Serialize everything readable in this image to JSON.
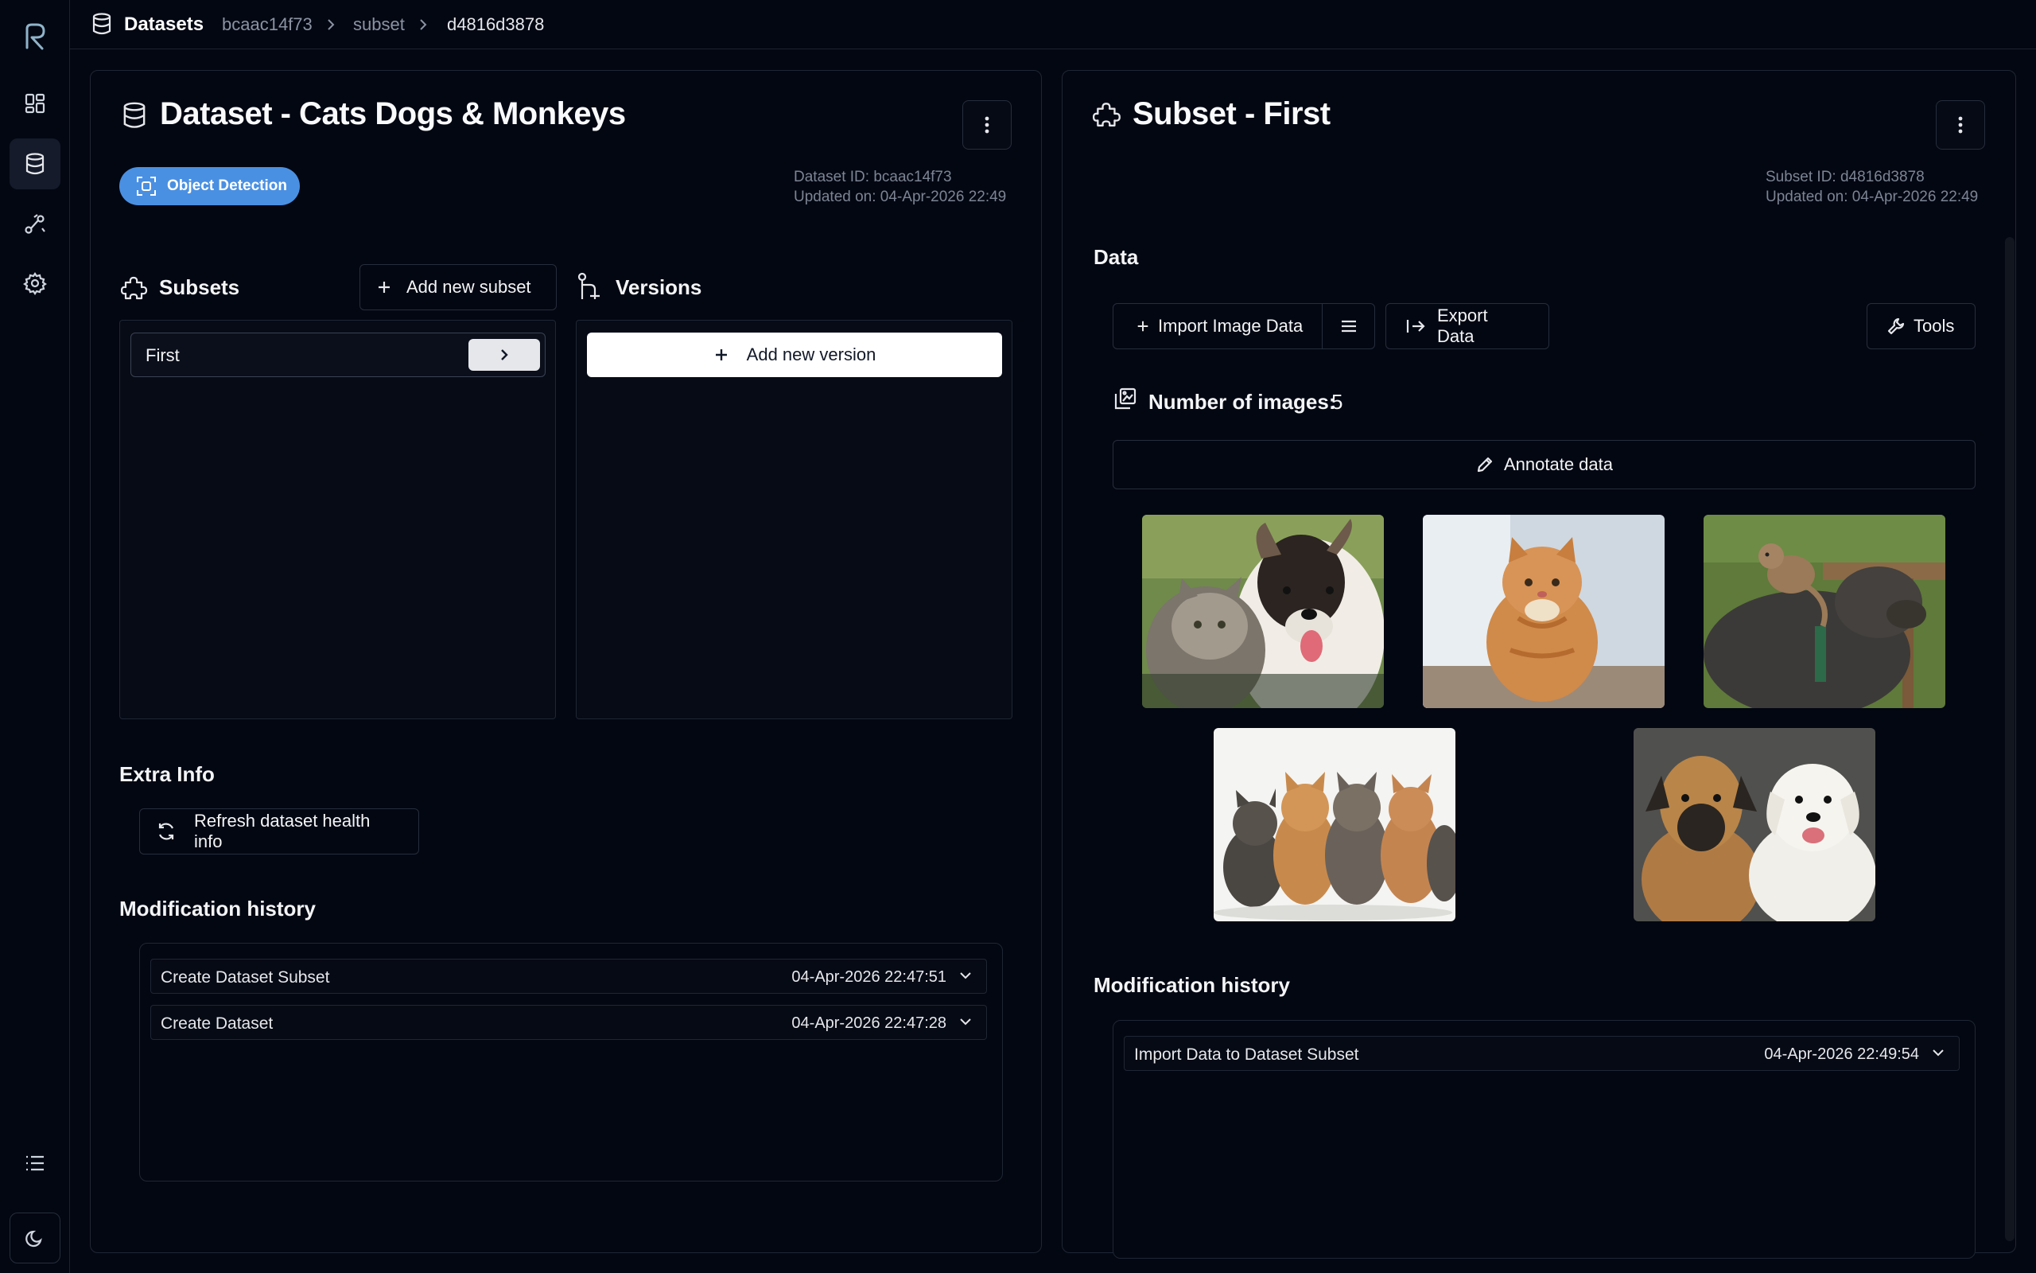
{
  "breadcrumb": {
    "root": "Datasets",
    "items": [
      "bcaac14f73",
      "subset",
      "d4816d3878"
    ]
  },
  "sidebar": {
    "icons": [
      "logo-icon",
      "dashboard-icon",
      "database-icon",
      "pipeline-icon",
      "settings-icon",
      "list-icon",
      "moon-icon"
    ],
    "active": "database-icon"
  },
  "dataset_panel": {
    "title": "Dataset - Cats Dogs & Monkeys",
    "badge": "Object Detection",
    "dataset_id": "Dataset ID: bcaac14f73",
    "updated_on": "Updated on: 04-Apr-2026 22:49",
    "subsets_title": "Subsets",
    "add_subset_label": "Add new subset",
    "versions_title": "Versions",
    "subsets": [
      {
        "label": "First"
      }
    ],
    "add_version_label": "Add new version",
    "extra_info_title": "Extra Info",
    "refresh_label": "Refresh dataset health info",
    "history_title": "Modification history",
    "history": [
      {
        "action": "Create Dataset Subset",
        "date": "04-Apr-2026 22:47:51"
      },
      {
        "action": "Create Dataset",
        "date": "04-Apr-2026 22:47:28"
      }
    ]
  },
  "subset_panel": {
    "title": "Subset - First",
    "subset_id": "Subset ID: d4816d3878",
    "updated_on": "Updated on: 04-Apr-2026 22:49",
    "data_title": "Data",
    "import_label": "Import Image Data",
    "export_label": "Export Data",
    "tools_label": "Tools",
    "image_count_label": "Number of images:",
    "image_count": "5",
    "annotate_label": "Annotate data",
    "images": [
      "cat-and-dog-photo",
      "orange-cat-photo",
      "monkey-on-dog-photo",
      "kittens-photo",
      "two-dogs-photo"
    ],
    "history_title": "Modification history",
    "history": [
      {
        "action": "Import Data to Dataset Subset",
        "date": "04-Apr-2026 22:49:54"
      }
    ]
  },
  "colors": {
    "background": "#030712",
    "badge": "#4a90e2",
    "border": "#1f2633"
  }
}
